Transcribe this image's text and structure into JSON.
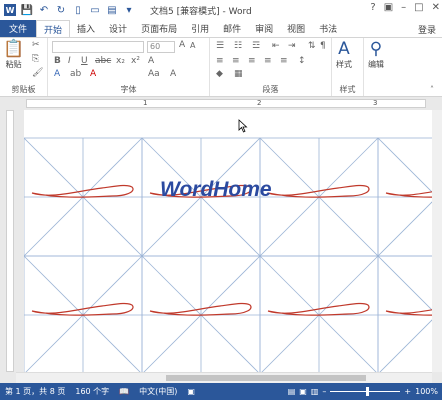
{
  "title": "文档5 [兼容模式] - Word",
  "help_icon": "?",
  "login": "登录",
  "tabs": [
    "文件",
    "开始",
    "插入",
    "设计",
    "页面布局",
    "引用",
    "邮件",
    "审阅",
    "视图",
    "书法"
  ],
  "ribbon": {
    "clipboard_label": "剪贴板",
    "paste_label": "粘贴",
    "font_label": "字体",
    "paragraph_label": "段落",
    "styles_label": "样式",
    "styles_button": "样式",
    "edit_button": "编辑",
    "font_size": "60"
  },
  "ruler_numbers": [
    "1",
    "2",
    "3"
  ],
  "watermark": "WordHome",
  "status": {
    "page": "第 1 页，共 8 页",
    "words": "160 个字",
    "language": "中文(中国)",
    "zoom": "100%"
  },
  "colors": {
    "accent": "#2b579a",
    "grid": "#9db5d6",
    "stroke": "#c0392b"
  }
}
